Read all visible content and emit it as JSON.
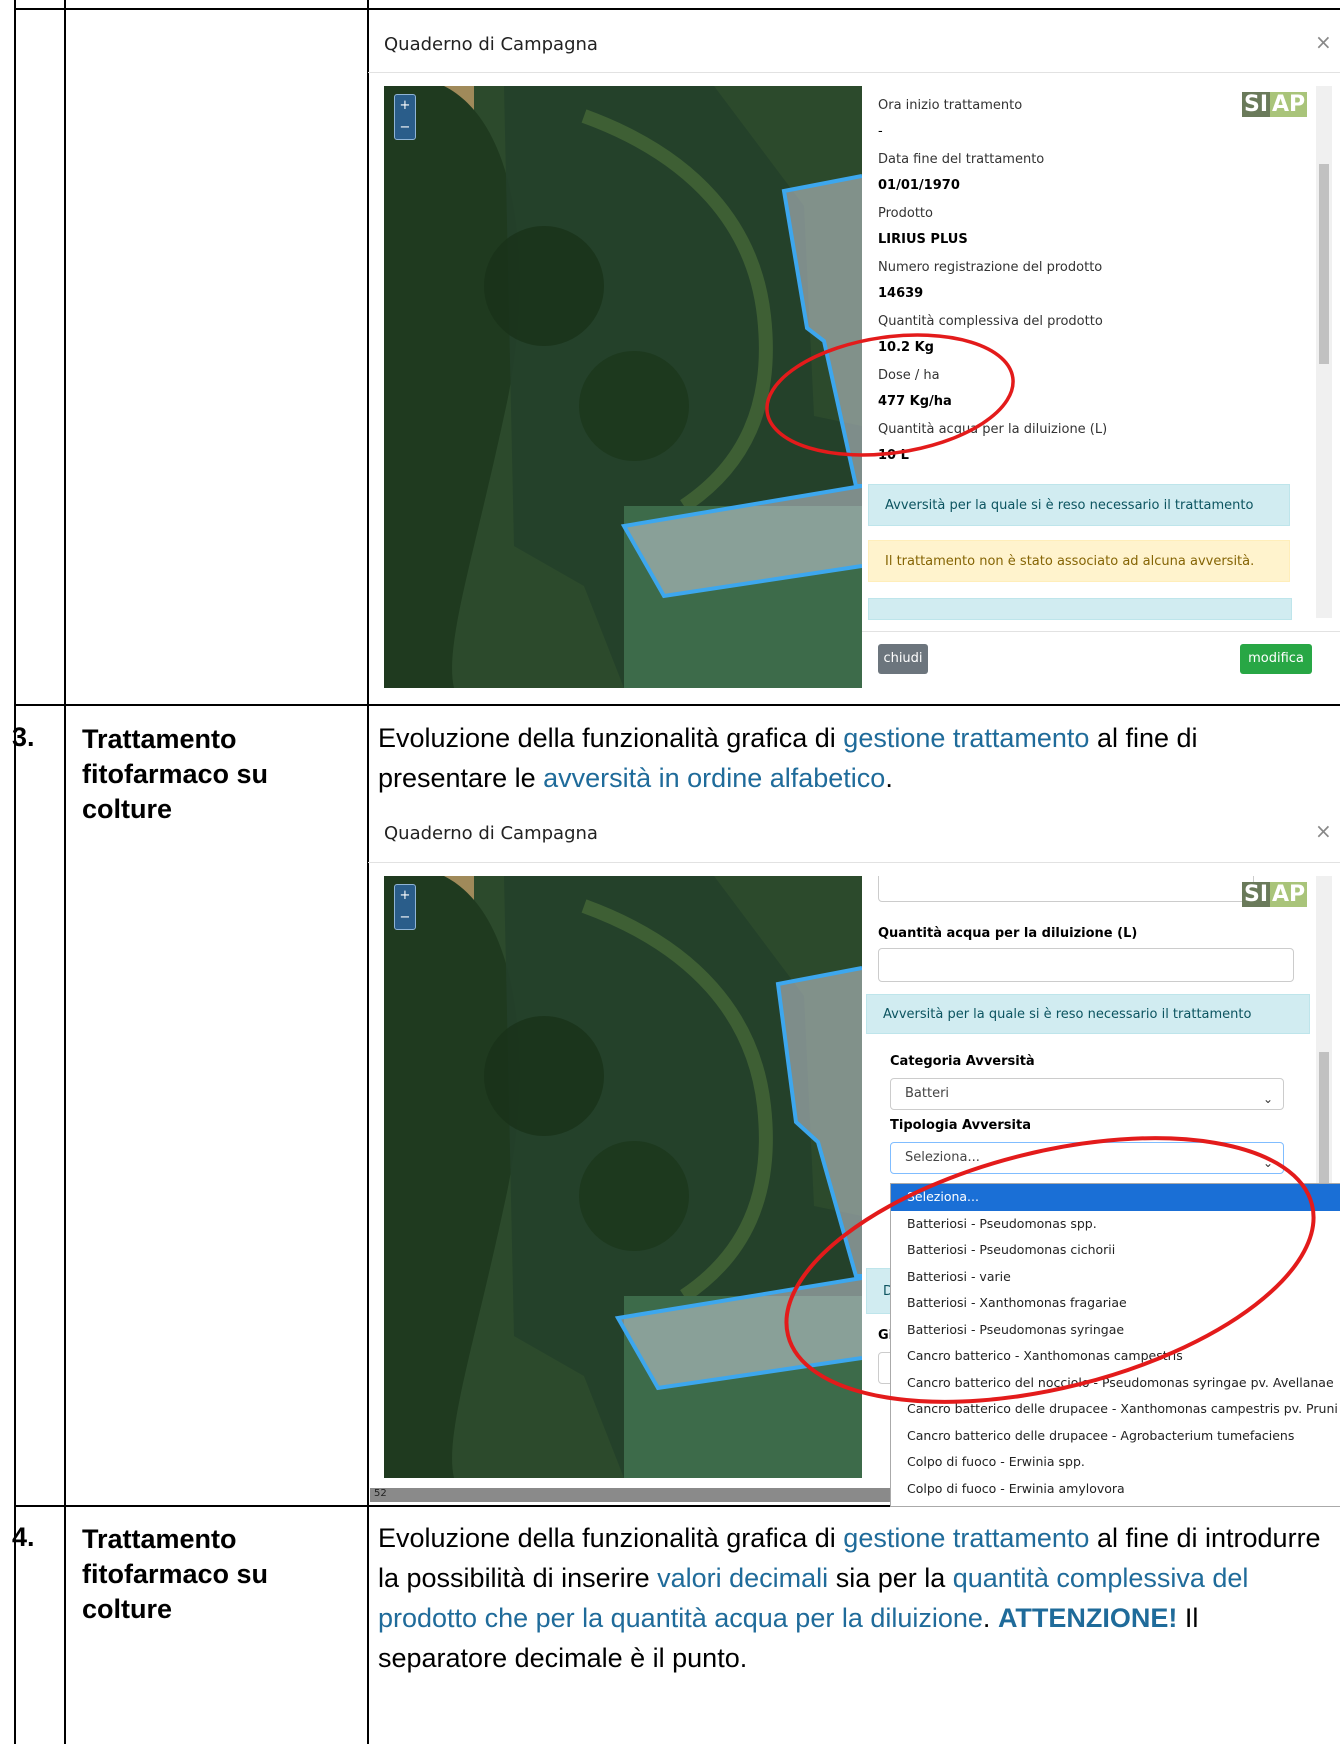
{
  "rows": [
    {
      "num": "",
      "title": ""
    },
    {
      "num": "3.",
      "title": "Trattamento fitofarmaco su colture",
      "desc_parts": [
        "Evoluzione della funzionalità grafica di ",
        "gestione trattamento",
        " al fine di presentare le ",
        "avversità in ordine alfabetico",
        "."
      ]
    },
    {
      "num": "4.",
      "title": "Trattamento fitofarmaco su colture",
      "desc_parts": [
        "Evoluzione della funzionalità grafica di ",
        "gestione trattamento",
        " al fine di introdurre la possibilità di inserire ",
        "valori decimali",
        " sia per la ",
        "quantità complessiva del prodotto che per la quantità acqua per la diluizione",
        ". ",
        "ATTENZIONE!",
        " Il separatore decimale è il punto."
      ]
    }
  ],
  "modal1": {
    "title": "Quaderno di Campagna",
    "close": "×",
    "zoom_in": "+",
    "zoom_out": "−",
    "logo": [
      "SI",
      "AP"
    ],
    "fields": [
      {
        "label": "Ora inizio trattamento",
        "value": "-"
      },
      {
        "label": "Data fine del trattamento",
        "value": "01/01/1970"
      },
      {
        "label": "Prodotto",
        "value": "LIRIUS PLUS"
      },
      {
        "label": "Numero registrazione del prodotto",
        "value": "14639"
      },
      {
        "label": "Quantità complessiva del prodotto",
        "value": "10.2 Kg"
      },
      {
        "label": "Dose / ha",
        "value": "477 Kg/ha"
      },
      {
        "label": "Quantità acqua per la diluizione (L)",
        "value": "10 L"
      }
    ],
    "alert_info": "Avversità per la quale si è reso necessario il trattamento",
    "alert_warn": "Il trattamento non è stato associato ad alcuna avversità.",
    "btn_close": "chiudi",
    "btn_edit": "modifica"
  },
  "modal2": {
    "title": "Quaderno di Campagna",
    "close": "×",
    "zoom_in": "+",
    "zoom_out": "−",
    "logo": [
      "SI",
      "AP"
    ],
    "water_label": "Quantità acqua per la diluizione (L)",
    "alert_info": "Avversità per la quale si è reso necessario il trattamento",
    "category_label": "Categoria Avversità",
    "category_value": "Batteri",
    "type_label": "Tipologia Avversita",
    "type_value": "Seleziona...",
    "partial_left_1": "D",
    "partial_left_2": "Gi",
    "page_num": "52",
    "options": [
      "Seleziona...",
      "Batteriosi - Pseudomonas spp.",
      "Batteriosi - Pseudomonas cichorii",
      "Batteriosi - varie",
      "Batteriosi - Xanthomonas fragariae",
      "Batteriosi - Pseudomonas syringae",
      "Cancro batterico - Xanthomonas campestris",
      "Cancro batterico del nocciolo - Pseudomonas syringae pv. Avellanae",
      "Cancro batterico delle drupacee - Xanthomonas campestris pv. Pruni",
      "Cancro batterico delle drupacee - Agrobacterium tumefaciens",
      "Colpo di fuoco - Erwinia spp.",
      "Colpo di fuoco - Erwinia amylovora"
    ]
  },
  "colors": {
    "highlight": "#1f6b9a",
    "info_bg": "#d1ecf1",
    "warn_bg": "#fff3cd",
    "selected": "#1a6fd6",
    "annotation": "#e31b1b"
  }
}
